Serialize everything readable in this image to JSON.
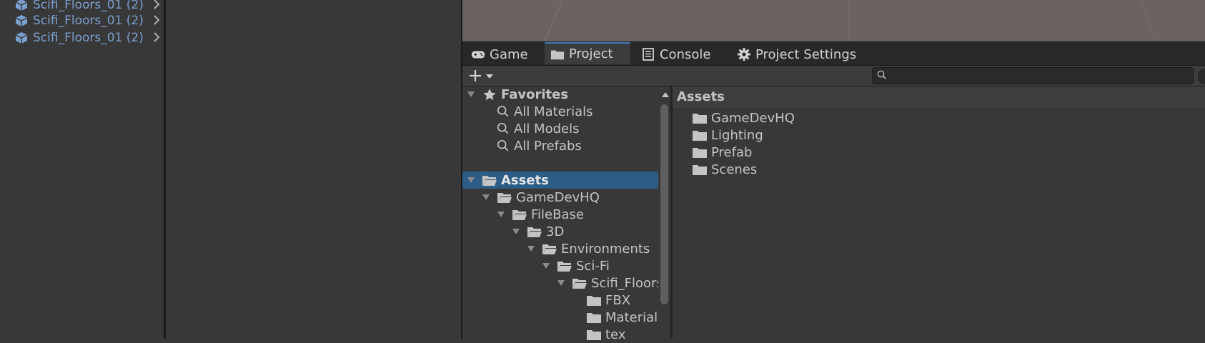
{
  "hierarchy": {
    "items": [
      {
        "label": "Scifi_Floors_01 (2)"
      },
      {
        "label": "Scifi_Floors_01 (2)"
      },
      {
        "label": "Scifi_Floors_01 (2)"
      }
    ]
  },
  "tabs": [
    {
      "label": "Game",
      "icon": "gamepad-icon"
    },
    {
      "label": "Project",
      "icon": "folder-icon",
      "active": true
    },
    {
      "label": "Console",
      "icon": "console-icon"
    },
    {
      "label": "Project Settings",
      "icon": "gear-icon"
    }
  ],
  "toolbar": {
    "search_value": ""
  },
  "favorites": {
    "label": "Favorites",
    "items": [
      {
        "label": "All Materials"
      },
      {
        "label": "All Models"
      },
      {
        "label": "All Prefabs"
      }
    ]
  },
  "tree": {
    "root": "Assets",
    "nodes": [
      {
        "label": "GameDevHQ"
      },
      {
        "label": "FileBase"
      },
      {
        "label": "3D"
      },
      {
        "label": "Environments"
      },
      {
        "label": "Sci-Fi"
      },
      {
        "label": "Scifi_Floors"
      },
      {
        "label": "FBX"
      },
      {
        "label": "Material"
      },
      {
        "label": "tex"
      }
    ]
  },
  "content": {
    "header": "Assets",
    "items": [
      {
        "label": "GameDevHQ"
      },
      {
        "label": "Lighting"
      },
      {
        "label": "Prefab"
      },
      {
        "label": "Scenes"
      }
    ]
  },
  "colors": {
    "selection": "#2c5d87",
    "accent": "#3a79bb",
    "hierarchy_text": "#7ba0cf"
  }
}
